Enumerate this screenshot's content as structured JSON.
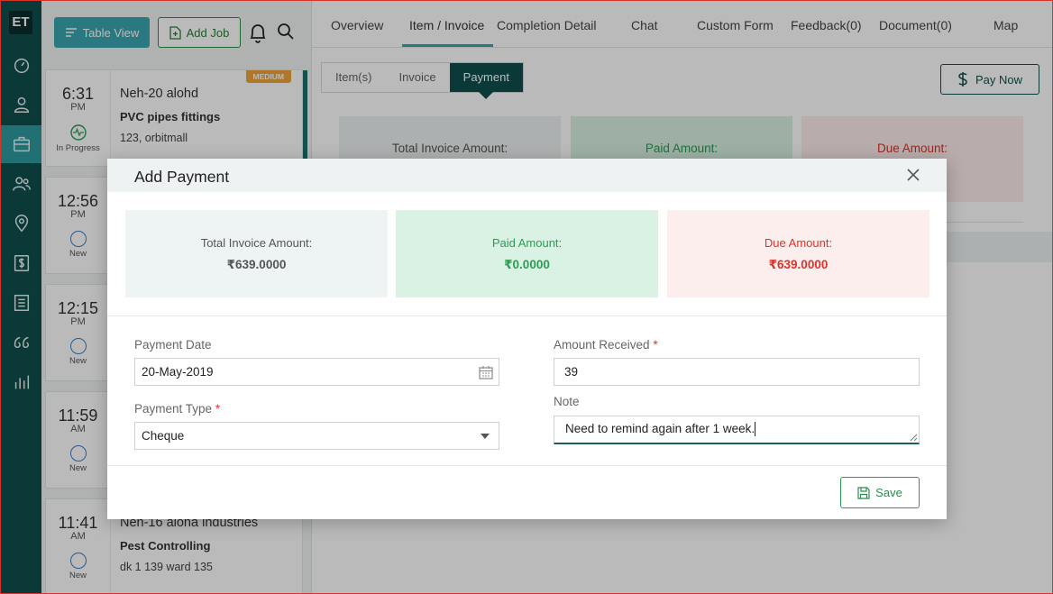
{
  "rail": {
    "logo": "ET"
  },
  "list": {
    "table_view": "Table View",
    "add_job": "Add Job",
    "jobs": [
      {
        "time": "6:31",
        "ampm": "PM",
        "status": "In Progress",
        "title": "Neh-20 alohd",
        "subtitle": "PVC pipes fittings",
        "address": "123, orbitmall",
        "badge": "MEDIUM"
      },
      {
        "time": "12:56",
        "ampm": "PM",
        "status": "New"
      },
      {
        "time": "12:15",
        "ampm": "PM",
        "status": "New"
      },
      {
        "time": "11:59",
        "ampm": "AM",
        "status": "New"
      },
      {
        "time": "11:41",
        "ampm": "AM",
        "status": "New",
        "title": "Neh-16 aloha industries",
        "subtitle": "Pest Controlling",
        "address": "dk 1 139 ward 135"
      }
    ]
  },
  "detail": {
    "tabs": [
      "Overview",
      "Item / Invoice",
      "Completion Detail",
      "Chat",
      "Custom Form",
      "Feedback(0)",
      "Document(0)",
      "Map"
    ],
    "subtabs": [
      "Item(s)",
      "Invoice",
      "Payment"
    ],
    "pay_now": "Pay Now",
    "bg_total": "Total Invoice Amount:",
    "bg_paid": "Paid Amount:",
    "bg_due": "Due Amount:"
  },
  "modal": {
    "title": "Add Payment",
    "total_label": "Total Invoice Amount:",
    "total_value": "₹639.0000",
    "paid_label": "Paid Amount:",
    "paid_value": "₹0.0000",
    "due_label": "Due Amount:",
    "due_value": "₹639.0000",
    "payment_date_label": "Payment Date",
    "payment_date_value": "20-May-2019",
    "amount_label": "Amount Received",
    "amount_value": "39",
    "type_label": "Payment Type",
    "type_value": "Cheque",
    "note_label": "Note",
    "note_value": "Need to remind again after 1 week.",
    "required_mark": "*",
    "save": "Save"
  },
  "colors": {
    "rail": "#0f4f4c",
    "accent": "#3aa7b1",
    "paid_green": "#2c9c55",
    "due_red": "#d9342b"
  }
}
